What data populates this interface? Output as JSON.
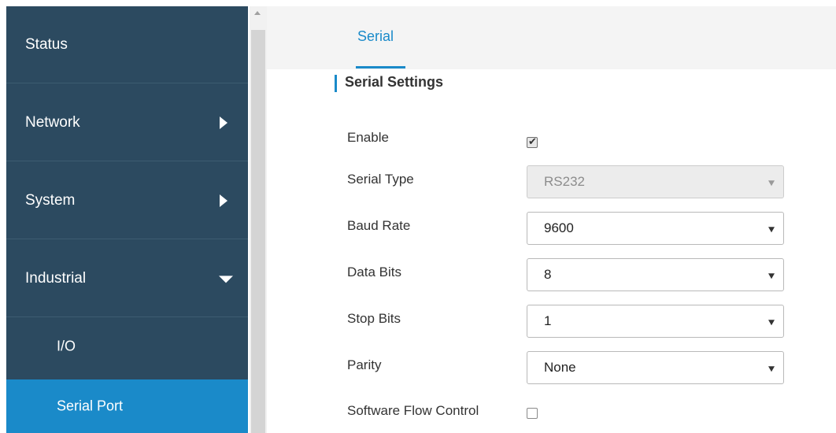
{
  "sidebar": {
    "items": [
      {
        "label": "Status"
      },
      {
        "label": "Network"
      },
      {
        "label": "System"
      },
      {
        "label": "Industrial"
      }
    ],
    "sub_items": [
      {
        "label": "I/O"
      },
      {
        "label": "Serial Port"
      }
    ]
  },
  "tabs": [
    {
      "label": "Serial"
    }
  ],
  "section": {
    "title": "Serial Settings"
  },
  "form": {
    "enable": {
      "label": "Enable",
      "checked": true
    },
    "serial_type": {
      "label": "Serial Type",
      "value": "RS232"
    },
    "baud_rate": {
      "label": "Baud Rate",
      "value": "9600"
    },
    "data_bits": {
      "label": "Data Bits",
      "value": "8"
    },
    "stop_bits": {
      "label": "Stop Bits",
      "value": "1"
    },
    "parity": {
      "label": "Parity",
      "value": "None"
    },
    "software_flow_control": {
      "label": "Software Flow Control",
      "checked": false
    }
  },
  "colors": {
    "sidebar_bg": "#2c4a60",
    "accent": "#1a8ac9"
  }
}
